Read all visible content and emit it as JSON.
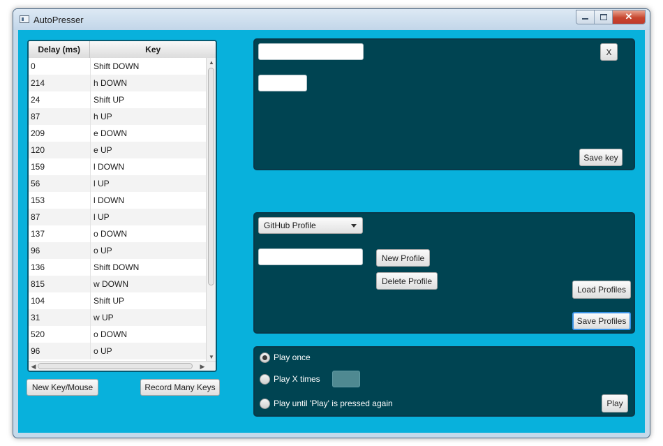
{
  "window": {
    "title": "AutoPresser"
  },
  "table": {
    "columns": [
      "Delay (ms)",
      "Key"
    ],
    "rows": [
      [
        "0",
        "Shift DOWN"
      ],
      [
        "214",
        "h DOWN"
      ],
      [
        "24",
        "Shift UP"
      ],
      [
        "87",
        "h UP"
      ],
      [
        "209",
        "e DOWN"
      ],
      [
        "120",
        "e UP"
      ],
      [
        "159",
        "l DOWN"
      ],
      [
        "56",
        "l UP"
      ],
      [
        "153",
        "l DOWN"
      ],
      [
        "87",
        "l UP"
      ],
      [
        "137",
        "o DOWN"
      ],
      [
        "96",
        "o UP"
      ],
      [
        "136",
        "Shift DOWN"
      ],
      [
        "815",
        "w DOWN"
      ],
      [
        "104",
        "Shift UP"
      ],
      [
        "31",
        "w UP"
      ],
      [
        "520",
        "o DOWN"
      ],
      [
        "96",
        "o UP"
      ]
    ]
  },
  "buttons": {
    "new_key_mouse": "New Key/Mouse",
    "record_many_keys": "Record Many Keys"
  },
  "key_editor": {
    "close_label": "X",
    "save_key_label": "Save key",
    "key_name_value": "",
    "delay_value": ""
  },
  "profiles": {
    "selected": "GitHub Profile",
    "name_value": "",
    "new_profile_label": "New Profile",
    "delete_profile_label": "Delete Profile",
    "load_profiles_label": "Load Profiles",
    "save_profiles_label": "Save Profiles"
  },
  "playback": {
    "play_once_label": "Play once",
    "play_x_times_label": "Play X times",
    "play_until_label": "Play until 'Play' is pressed again",
    "selected_option": "Play once",
    "times_value": "",
    "play_label": "Play"
  },
  "colors": {
    "background": "#08b1dc",
    "panel": "#004452",
    "panel_border": "#08394a",
    "focus": "#3a93e6"
  }
}
